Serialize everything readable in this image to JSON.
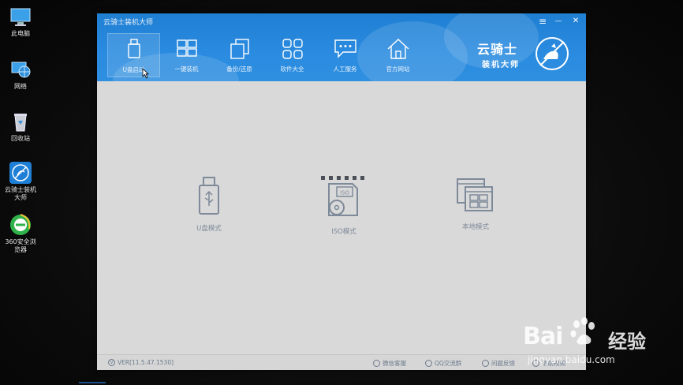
{
  "desktop": {
    "icons": [
      {
        "label": "此电脑"
      },
      {
        "label": "网络"
      },
      {
        "label": "回收站"
      },
      {
        "label": "云骑士装机大师"
      },
      {
        "label": "360安全浏览器"
      }
    ]
  },
  "app": {
    "title": "云骑士装机大师",
    "controls": {
      "menu": "≡",
      "minimize": "—",
      "close": "✕"
    },
    "nav": [
      {
        "label": "U盘启动",
        "icon": "usb-icon",
        "active": true
      },
      {
        "label": "一键装机",
        "icon": "windows-icon"
      },
      {
        "label": "备份/还原",
        "icon": "backup-icon"
      },
      {
        "label": "软件大全",
        "icon": "apps-icon"
      },
      {
        "label": "人工服务",
        "icon": "chat-icon"
      },
      {
        "label": "官方网站",
        "icon": "home-icon"
      }
    ],
    "logo": {
      "line1": "云骑士",
      "line2": "装机大师"
    },
    "modes": [
      {
        "label": "U盘模式",
        "icon": "usb-drive-icon"
      },
      {
        "label": "ISO模式",
        "icon": "iso-disc-icon",
        "iso_text": "ISO"
      },
      {
        "label": "本地模式",
        "icon": "local-windows-icon"
      }
    ],
    "status": {
      "version_badge": "V",
      "version": "VER[11.5.47.1530]",
      "wechat": "微信客服",
      "qq": "QQ交流群",
      "feedback": "问题反馈",
      "last": "帮助视频"
    }
  },
  "watermark": {
    "brand": "Bai",
    "jingyan": "经验",
    "url": "jingyan.baidu.com"
  },
  "colors": {
    "header_blue": "#2a8be0",
    "content_gray": "#d9d9d9",
    "mode_gray": "#7e8a99"
  }
}
